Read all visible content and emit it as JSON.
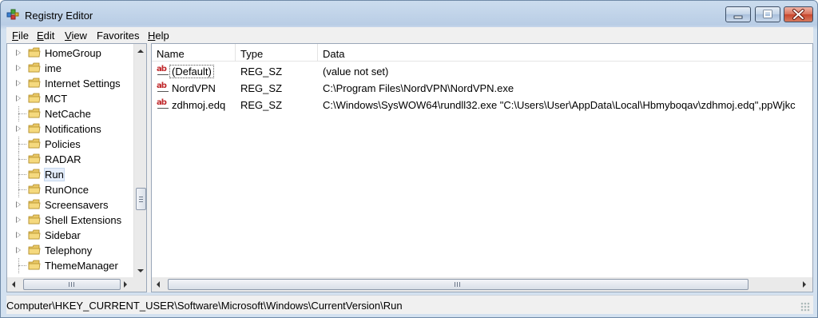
{
  "window": {
    "title": "Registry Editor",
    "icon": "registry-editor-icon"
  },
  "menu": [
    {
      "label": "File",
      "mnemonic": "F",
      "rest": "ile"
    },
    {
      "label": "Edit",
      "mnemonic": "E",
      "rest": "dit"
    },
    {
      "label": "View",
      "mnemonic": "V",
      "rest": "iew"
    },
    {
      "label": "Favorites",
      "mnemonic": "",
      "rest": "Favorites"
    },
    {
      "label": "Help",
      "mnemonic": "H",
      "rest": "elp"
    }
  ],
  "tree": {
    "items": [
      {
        "label": "HomeGroup",
        "expandable": true
      },
      {
        "label": "ime",
        "expandable": true
      },
      {
        "label": "Internet Settings",
        "expandable": true
      },
      {
        "label": "MCT",
        "expandable": true
      },
      {
        "label": "NetCache",
        "expandable": false
      },
      {
        "label": "Notifications",
        "expandable": true
      },
      {
        "label": "Policies",
        "expandable": false
      },
      {
        "label": "RADAR",
        "expandable": false
      },
      {
        "label": "Run",
        "expandable": false,
        "selected": true
      },
      {
        "label": "RunOnce",
        "expandable": false
      },
      {
        "label": "Screensavers",
        "expandable": true
      },
      {
        "label": "Shell Extensions",
        "expandable": true
      },
      {
        "label": "Sidebar",
        "expandable": true
      },
      {
        "label": "Telephony",
        "expandable": true
      },
      {
        "label": "ThemeManager",
        "expandable": false
      }
    ]
  },
  "values": {
    "columns": [
      "Name",
      "Type",
      "Data"
    ],
    "rows": [
      {
        "name": "(Default)",
        "type": "REG_SZ",
        "data": "(value not set)",
        "icon": "string-value-icon",
        "focused": true
      },
      {
        "name": "NordVPN",
        "type": "REG_SZ",
        "data": "C:\\Program Files\\NordVPN\\NordVPN.exe",
        "icon": "string-value-icon"
      },
      {
        "name": "zdhmoj.edq",
        "type": "REG_SZ",
        "data": "C:\\Windows\\SysWOW64\\rundll32.exe \"C:\\Users\\User\\AppData\\Local\\Hbmyboqav\\zdhmoj.edq\",ppWjkc",
        "icon": "string-value-icon"
      }
    ]
  },
  "status": {
    "path": "Computer\\HKEY_CURRENT_USER\\Software\\Microsoft\\Windows\\CurrentVersion\\Run"
  }
}
